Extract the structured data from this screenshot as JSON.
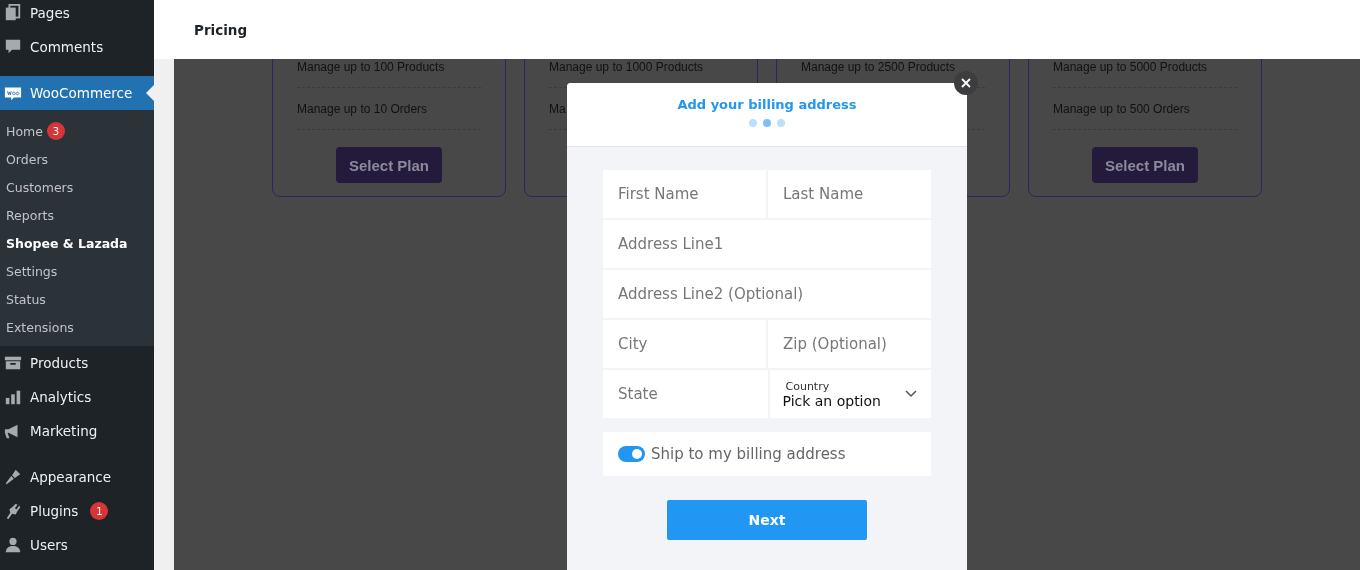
{
  "sidebar": {
    "items": [
      {
        "kind": "item",
        "label": "Pages",
        "selected": false
      },
      {
        "kind": "item",
        "label": "Comments",
        "selected": false
      },
      {
        "kind": "separator"
      },
      {
        "kind": "item",
        "label": "WooCommerce",
        "selected": true,
        "children": [
          {
            "label": "Home",
            "selected": false,
            "badge": "3"
          },
          {
            "label": "Orders",
            "selected": false
          },
          {
            "label": "Customers",
            "selected": false
          },
          {
            "label": "Reports",
            "selected": false
          },
          {
            "label": "Shopee & Lazada",
            "selected": true
          },
          {
            "label": "Settings",
            "selected": false
          },
          {
            "label": "Status",
            "selected": false
          },
          {
            "label": "Extensions",
            "selected": false
          }
        ]
      },
      {
        "kind": "item",
        "label": "Products",
        "selected": false
      },
      {
        "kind": "item",
        "label": "Analytics",
        "selected": false
      },
      {
        "kind": "item",
        "label": "Marketing",
        "selected": false
      },
      {
        "kind": "separator"
      },
      {
        "kind": "item",
        "label": "Appearance",
        "selected": false
      },
      {
        "kind": "item",
        "label": "Plugins",
        "selected": false,
        "badge": "1"
      },
      {
        "kind": "item",
        "label": "Users",
        "selected": false
      }
    ]
  },
  "header": {
    "title": "Pricing"
  },
  "plans": [
    {
      "products": "Manage up to 100 Products",
      "orders": "Manage up to 10 Orders",
      "button": "Select Plan"
    },
    {
      "products": "Manage up to 1000 Products",
      "orders": "Ma"
    },
    {
      "products": "Manage up to 2500 Products"
    },
    {
      "products": "Manage up to 5000 Products",
      "orders": "Manage up to 500 Orders",
      "button": "Select Plan"
    }
  ],
  "modal": {
    "title": "Add your billing address",
    "steps": [
      {
        "selected": false
      },
      {
        "selected": true
      },
      {
        "selected": false
      }
    ],
    "rows": [
      [
        {
          "kind": "input",
          "placeholder": "First Name"
        },
        {
          "kind": "input",
          "placeholder": "Last Name"
        }
      ],
      [
        {
          "kind": "input",
          "placeholder": "Address Line1"
        }
      ],
      [
        {
          "kind": "input",
          "placeholder": "Address Line2 (Optional)"
        }
      ],
      [
        {
          "kind": "input",
          "placeholder": "City"
        },
        {
          "kind": "input",
          "placeholder": "Zip (Optional)"
        }
      ],
      [
        {
          "kind": "input",
          "placeholder": "State"
        },
        {
          "kind": "select",
          "label": "Country",
          "value": "Pick an option"
        }
      ]
    ],
    "ship_toggle": {
      "label": "Ship to my billing address",
      "on": true
    },
    "next_button": "Next"
  }
}
